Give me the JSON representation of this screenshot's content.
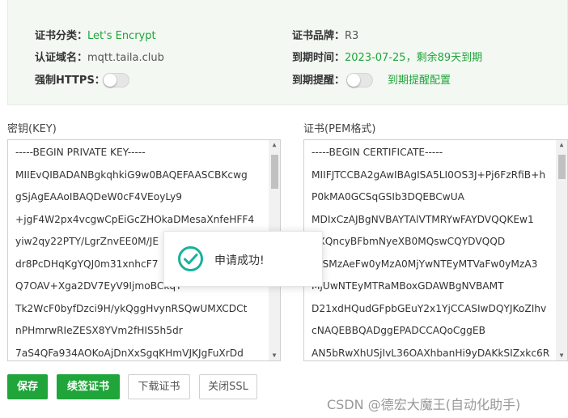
{
  "info": {
    "cert_type_label": "证书分类：",
    "cert_type_value": "Let's Encrypt",
    "domain_label": "认证域名：",
    "domain_value": "mqtt.taila.club",
    "force_https_label": "强制HTTPS：",
    "force_https_on": false,
    "brand_label": "证书品牌：",
    "brand_value": "R3",
    "expire_label": "到期时间：",
    "expire_value": "2023-07-25，剩余89天到期",
    "remind_label": "到期提醒：",
    "remind_on": false,
    "remind_link": "到期提醒配置"
  },
  "key": {
    "label": "密钥(KEY)",
    "lines": [
      "-----BEGIN PRIVATE KEY-----",
      "MIIEvQIBADANBgkqhkiG9w0BAQEFAASCBKcwg",
      "gSjAgEAAoIBAQDeW0cF4VEoyLy9",
      "+jgF4W2px4vcgwCpEiGcZHOkaDMesaXnfeHFF4",
      "yiw2qy22PTY/LgrZnvEE0M/JE",
      "dr8PcDHqKgYQJ0m31xnhcF7",
      "Q7OAV+Xga2DV7EyV9IjmoBCkqT",
      "Tk2WcF0byfDzci9H/ykQggHvynRSQwUMXCDCt",
      "nPHmrwRIeZESX8YVm2fHIS5h5dr",
      "7aS4QFa934AOKoAjDnXxSgqKHmVJKJgFuXrDd"
    ]
  },
  "cert": {
    "label": "证书(PEM格式)",
    "lines": [
      "-----BEGIN CERTIFICATE-----",
      "MIIFJTCCBA2gAwIBAgISA5LI0OS3J+Pj6FzRfiB+h",
      "P0kMA0GCSqGSIb3DQEBCwUA",
      "MDIxCzAJBgNVBAYTAlVTMRYwFAYDVQQKEw1",
      "ZXQncyBFbmNyeXB0MQswCQYDVQQD",
      "wJSMzAeFw0yMzA0MjYwNTEyMTVaFw0yMzA3",
      "MjUwNTEyMTRaMBoxGDAWBgNVBAMT",
      "D21xdHQudGFpbGEuY2x1YjCCASIwDQYJKoZIhv",
      "cNAQEBBQADggEPADCCAQoCggEB",
      "AN5bRwXhUSjIvL36OAXhbanHi9yDAKkSIZxkc6R"
    ]
  },
  "toast": {
    "message": "申请成功!",
    "icon": "check-circle-icon"
  },
  "buttons": {
    "save": "保存",
    "renew": "续签证书",
    "download": "下载证书",
    "close_ssl": "关闭SSL"
  },
  "watermark": "CSDN @德宏大魔王(自动化助手)",
  "colors": {
    "accent": "#20a53a",
    "panel_bg": "#f3f8f3"
  }
}
